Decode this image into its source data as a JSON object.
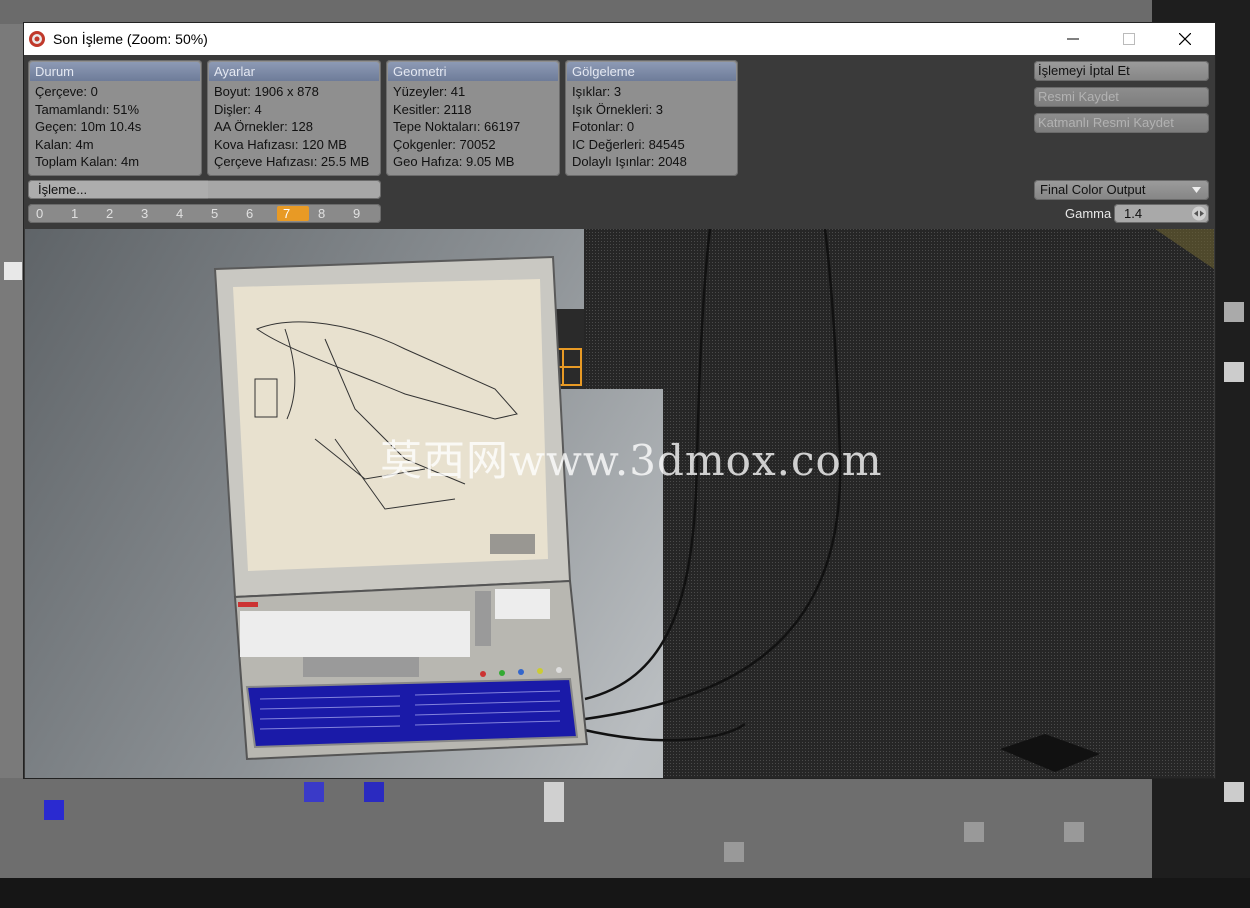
{
  "window": {
    "title": "Son İşleme (Zoom: 50%)",
    "icons": {
      "app": "render-app-icon",
      "minimize": "minimize-icon",
      "maximize": "maximize-icon",
      "close": "close-icon"
    }
  },
  "panels": {
    "durum": {
      "title": "Durum",
      "lines": [
        "Çerçeve: 0",
        "Tamamlandı: 51%",
        "Geçen: 10m 10.4s",
        "Kalan: 4m",
        "Toplam Kalan: 4m"
      ]
    },
    "ayarlar": {
      "title": "Ayarlar",
      "lines": [
        "Boyut: 1906 x 878",
        "Dişler: 4",
        "AA Örnekler: 128",
        "Kova Hafızası: 120 MB",
        "Çerçeve Hafızası: 25.5 MB"
      ]
    },
    "geometri": {
      "title": "Geometri",
      "lines": [
        "Yüzeyler: 41",
        "Kesitler: 2118",
        "Tepe Noktaları: 66197",
        "Çokgenler: 70052",
        "Geo Hafıza: 9.05 MB"
      ]
    },
    "golgeleme": {
      "title": "Gölgeleme",
      "lines": [
        "Işıklar: 3",
        "Işık Örnekleri: 3",
        "Fotonlar: 0",
        "IC Değerleri: 84545",
        "Dolaylı Işınlar: 2048"
      ]
    }
  },
  "buttons": {
    "cancel": "İşlemeyi İptal Et",
    "save_image": "Resmi Kaydet",
    "save_layered": "Katmanlı Resmi Kaydet"
  },
  "progress": {
    "label": "İşleme...",
    "fraction": 0.51
  },
  "frames": {
    "items": [
      "0",
      "1",
      "2",
      "3",
      "4",
      "5",
      "6",
      "7",
      "8",
      "9"
    ],
    "active": 7
  },
  "output": {
    "selected": "Final Color Output"
  },
  "gamma": {
    "label": "Gamma",
    "value": "1.4"
  },
  "viewport": {
    "watermark": "莫西网www.3dmox.com"
  },
  "colors": {
    "accent": "#e89a25",
    "panel_header": "#7d8aa6",
    "screen_blue": "#1a1aa8"
  }
}
